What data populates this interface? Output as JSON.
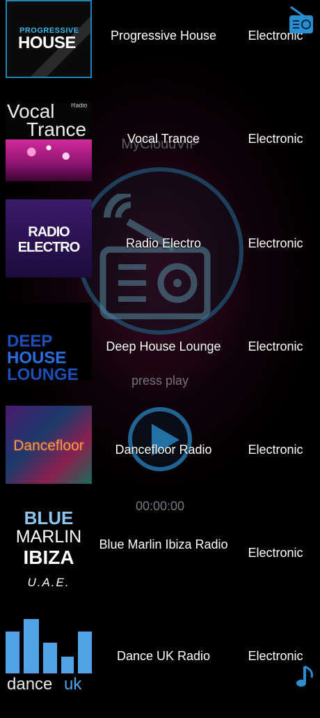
{
  "player": {
    "brand": "MyCloudVIP",
    "status": "press play",
    "elapsed": "00:00:00"
  },
  "stations": [
    {
      "name": "Progressive House",
      "genre": "Electronic",
      "logo_line1": "PROGRESSIVE",
      "logo_line2": "HOUSE"
    },
    {
      "name": "Vocal Trance",
      "genre": "Electronic",
      "logo_line1": "Vocal",
      "logo_line2": "Trance",
      "logo_tag": "Radio"
    },
    {
      "name": "Radio Electro",
      "genre": "Electronic",
      "logo_line1": "RADIO",
      "logo_line2": "ELECTRO"
    },
    {
      "name": "Deep House Lounge",
      "genre": "Electronic",
      "logo_line1": "DEEP",
      "logo_line2": "HOUSE",
      "logo_line3": "LOUNGE"
    },
    {
      "name": "Dancefloor Radio",
      "genre": "Electronic",
      "logo_line1": "Dancefloor"
    },
    {
      "name": "Blue Marlin Ibiza Radio",
      "genre": "Electronic",
      "logo_line1": "BLUE",
      "logo_line2": "MARLIN",
      "logo_line3": "IBIZA",
      "logo_line4": "U.A.E."
    },
    {
      "name": "Dance UK Radio",
      "genre": "Electronic",
      "logo_line1": "dance",
      "logo_line2": "uk"
    }
  ],
  "icons": {
    "top_right": "radio-icon",
    "bottom_right": "music-note-icon"
  },
  "colors": {
    "accent": "#2a8fd0",
    "background": "#000000"
  }
}
